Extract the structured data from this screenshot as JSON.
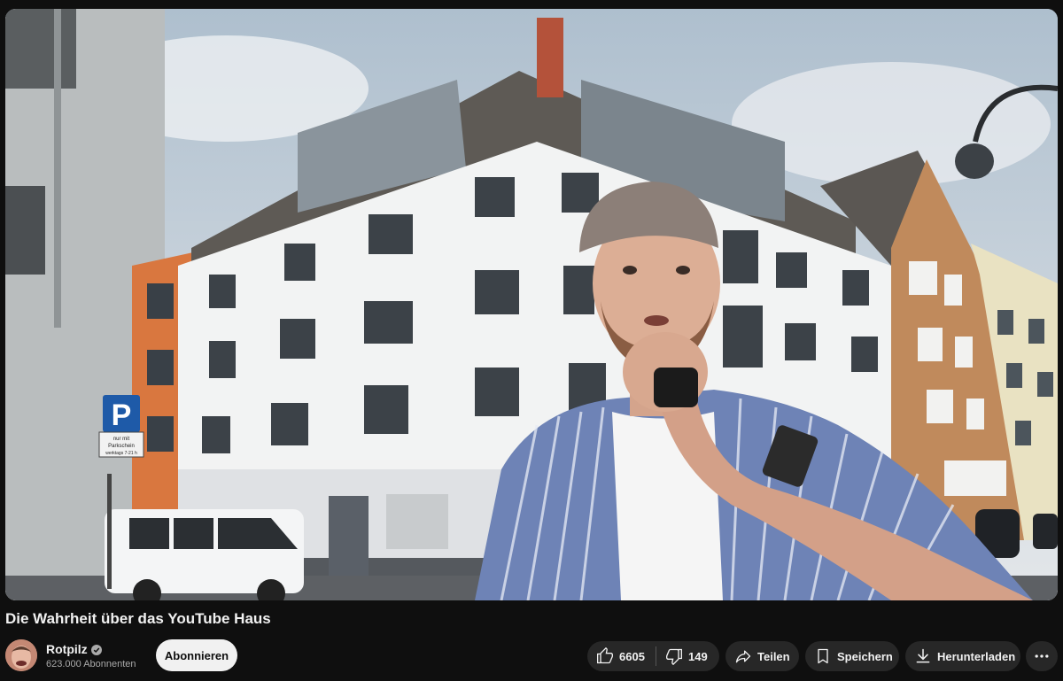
{
  "video": {
    "title": "Die Wahrheit über das YouTube Haus",
    "scene_signs": {
      "parking_letter": "P",
      "parking_text_line1": "nur mit",
      "parking_text_line2": "Parkschein",
      "parking_text_line3": "werktags 7-21 h"
    }
  },
  "channel": {
    "name": "Rotpilz",
    "verified_icon": "verified-check-icon",
    "subscribers": "623.000 Abonnenten",
    "subscribe_label": "Abonnieren"
  },
  "actions": {
    "like_count": "6605",
    "dislike_count": "149",
    "share_label": "Teilen",
    "save_label": "Speichern",
    "download_label": "Herunterladen",
    "more_icon": "more-horizontal-icon"
  },
  "colors": {
    "background": "#0f0f0f",
    "pill": "#272727",
    "subscribe_bg": "#f1f1f1",
    "text": "#f1f1f1",
    "secondary_text": "#aaaaaa"
  }
}
